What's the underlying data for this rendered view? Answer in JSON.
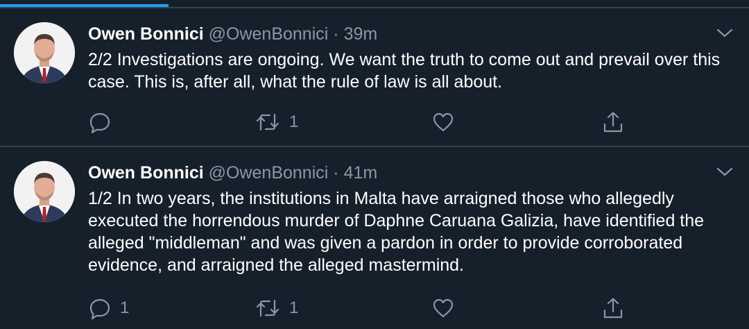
{
  "tweets": [
    {
      "name": "Owen Bonnici",
      "handle": "@OwenBonnici",
      "separator": "·",
      "time": "39m",
      "text": "2/2 Investigations are ongoing. We want the truth to come out and prevail over this case. This is, after all, what the rule of law is all about.",
      "reply_count": "",
      "retweet_count": "1",
      "like_count": ""
    },
    {
      "name": "Owen Bonnici",
      "handle": "@OwenBonnici",
      "separator": "·",
      "time": "41m",
      "text": "1/2 In two years, the institutions in Malta have arraigned those who allegedly executed the horrendous murder of Daphne Caruana Galizia, have identified the alleged \"middleman\" and was given a pardon in order to provide corroborated evidence, and arraigned the alleged mastermind.",
      "reply_count": "1",
      "retweet_count": "1",
      "like_count": ""
    }
  ],
  "colors": {
    "background": "#15202b",
    "divider": "#38444d",
    "secondary_text": "#8899a6",
    "accent": "#1da1f2"
  },
  "icons": [
    "reply-icon",
    "retweet-icon",
    "like-icon",
    "share-icon",
    "chevron-down-icon"
  ]
}
